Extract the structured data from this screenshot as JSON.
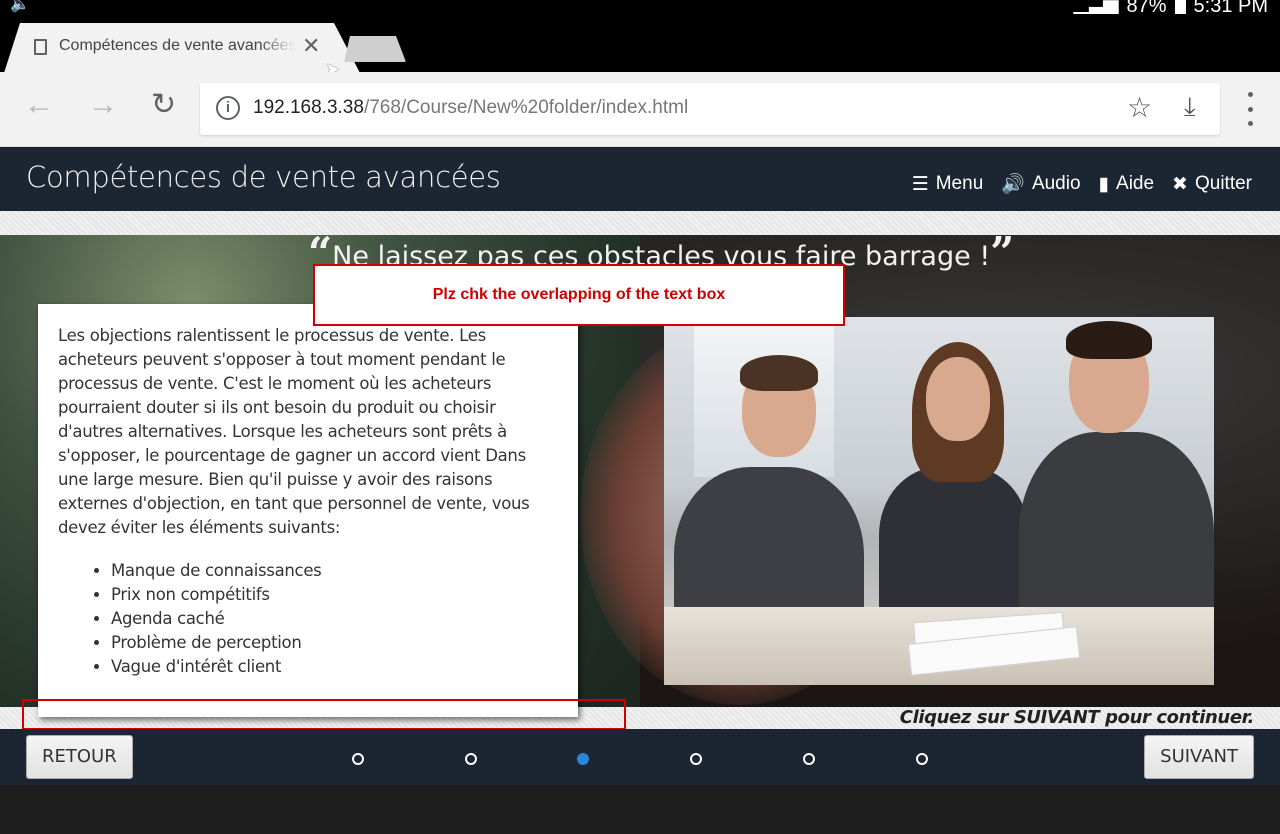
{
  "status_bar": {
    "time": "5:31 PM",
    "battery": "87%"
  },
  "browser": {
    "tab_title": "Compétences de vente avancées",
    "url_host": "192.168.3.38",
    "url_path": "/768/Course/New%20folder/index.html"
  },
  "course": {
    "title": "Compétences de vente avancées",
    "nav": [
      {
        "label": "Menu",
        "icon": "list-icon"
      },
      {
        "label": "Audio",
        "icon": "speaker-icon"
      },
      {
        "label": "Aide",
        "icon": "book-icon"
      },
      {
        "label": "Quitter",
        "icon": "close-icon"
      }
    ]
  },
  "slide": {
    "quote": "Ne laissez pas ces obstacles vous faire barrage !",
    "body": "Les objections ralentissent le processus de vente. Les acheteurs peuvent s'opposer à tout moment pendant le processus de vente. C'est le moment où les acheteurs pourraient douter si ils ont besoin du produit ou choisir d'autres alternatives. Lorsque les acheteurs sont prêts à s'opposer, le pourcentage de gagner un accord vient Dans une large mesure. Bien qu'il puisse y avoir des raisons externes d'objection, en tant que personnel de vente, vous devez éviter les éléments suivants:",
    "bullets": [
      "Manque de connaissances",
      "Prix non compétitifs",
      "Agenda caché",
      "Problème de perception",
      "Vague d'intérêt client"
    ],
    "instruction": "Cliquez sur SUIVANT pour continuer."
  },
  "annotation": {
    "note": "Plz chk the overlapping of the text box",
    "color": "#d00000"
  },
  "footer": {
    "back_label": "RETOUR",
    "next_label": "SUIVANT",
    "pages_total": 6,
    "current_page": 3
  },
  "colors": {
    "header_bg": "#1c2632",
    "active_dot": "#2b86d9"
  }
}
